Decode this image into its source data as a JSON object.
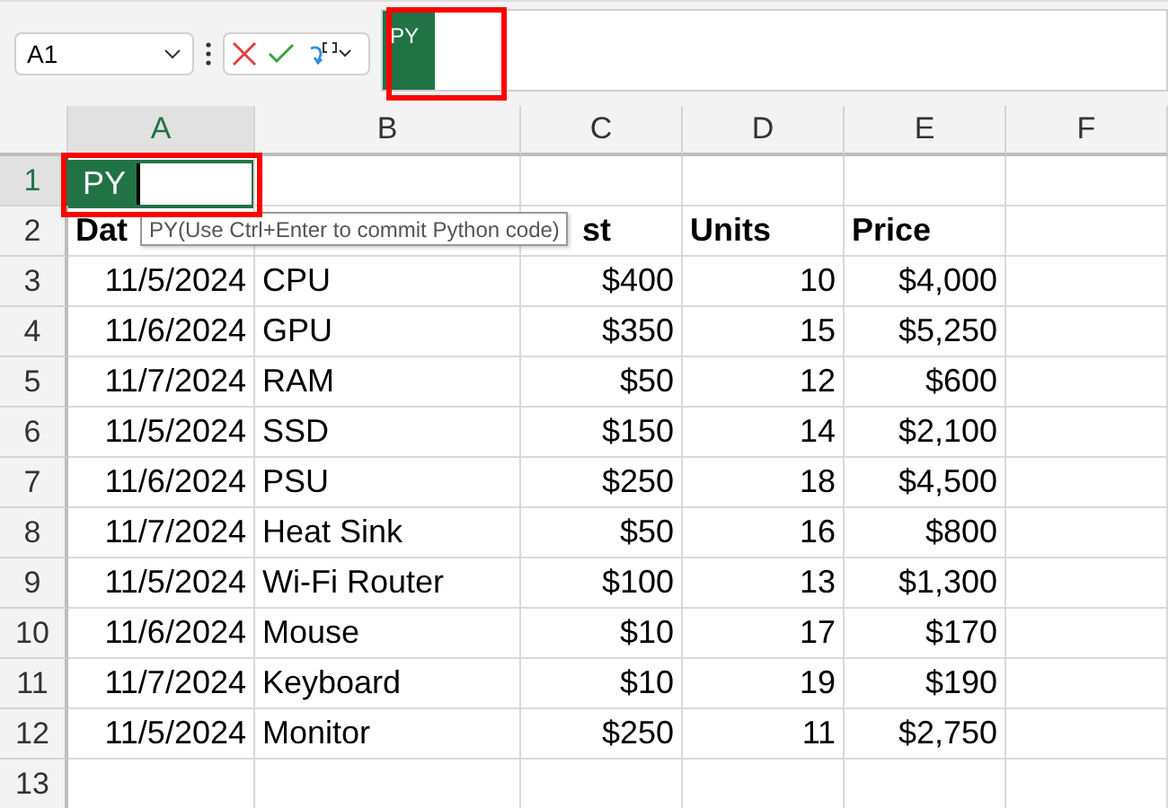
{
  "name_box": "A1",
  "formula_bar": {
    "python_badge": "PY"
  },
  "columns": [
    "A",
    "B",
    "C",
    "D",
    "E",
    "F"
  ],
  "cell_editor": {
    "badge": "PY",
    "tooltip": "PY(Use Ctrl+Enter to commit Python code)"
  },
  "rows": [
    {
      "num": "1",
      "cells": [
        "",
        "",
        "",
        "",
        "",
        ""
      ]
    },
    {
      "num": "2",
      "header": true,
      "cells": [
        "Dat",
        "",
        "st",
        "Units",
        "Price",
        ""
      ]
    },
    {
      "num": "3",
      "cells": [
        "11/5/2024",
        "CPU",
        "$400",
        "10",
        "$4,000",
        ""
      ]
    },
    {
      "num": "4",
      "cells": [
        "11/6/2024",
        "GPU",
        "$350",
        "15",
        "$5,250",
        ""
      ]
    },
    {
      "num": "5",
      "cells": [
        "11/7/2024",
        "RAM",
        "$50",
        "12",
        "$600",
        ""
      ]
    },
    {
      "num": "6",
      "cells": [
        "11/5/2024",
        "SSD",
        "$150",
        "14",
        "$2,100",
        ""
      ]
    },
    {
      "num": "7",
      "cells": [
        "11/6/2024",
        "PSU",
        "$250",
        "18",
        "$4,500",
        ""
      ]
    },
    {
      "num": "8",
      "cells": [
        "11/7/2024",
        "Heat Sink",
        "$50",
        "16",
        "$800",
        ""
      ]
    },
    {
      "num": "9",
      "cells": [
        "11/5/2024",
        "Wi-Fi Router",
        "$100",
        "13",
        "$1,300",
        ""
      ]
    },
    {
      "num": "10",
      "cells": [
        "11/6/2024",
        "Mouse",
        "$10",
        "17",
        "$170",
        ""
      ]
    },
    {
      "num": "11",
      "cells": [
        "11/7/2024",
        "Keyboard",
        "$10",
        "19",
        "$190",
        ""
      ]
    },
    {
      "num": "12",
      "cells": [
        "11/5/2024",
        "Monitor",
        "$250",
        "11",
        "$2,750",
        ""
      ]
    },
    {
      "num": "13",
      "cells": [
        "",
        "",
        "",
        "",
        "",
        ""
      ]
    }
  ]
}
